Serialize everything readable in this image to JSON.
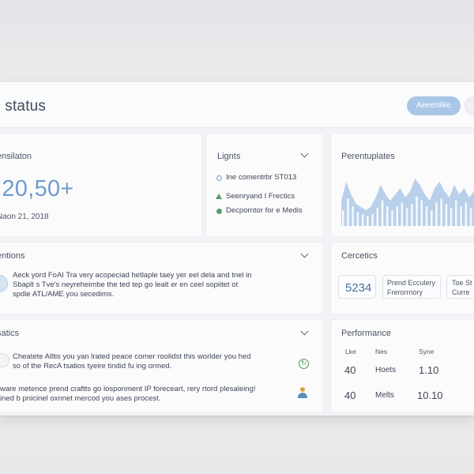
{
  "header": {
    "title": "o status",
    "primary_button": "Aeeenlike"
  },
  "card_overview": {
    "title": "ensilaton",
    "value": ",20,50+",
    "date": "Naon 21, 2018"
  },
  "card_lights": {
    "title": "Lignts",
    "items": [
      {
        "label": "Ine comentrbr ST013",
        "icon": "circle-icon",
        "color": "#6fa0cf"
      },
      {
        "label": "Seenryand I Frectics",
        "icon": "triangle-icon",
        "color": "#5a9a6a"
      },
      {
        "label": "Decporntor for e Medis",
        "icon": "dot-icon",
        "color": "#5aa06e"
      }
    ]
  },
  "card_chart": {
    "title": "Perentuplates",
    "chart_data": {
      "type": "area",
      "values": [
        8,
        14,
        10,
        7,
        6,
        5,
        6,
        9,
        13,
        10,
        8,
        10,
        12,
        9,
        11,
        15,
        13,
        10,
        8,
        12,
        14,
        11,
        9,
        13,
        10,
        12,
        9,
        11
      ]
    }
  },
  "card_actions": {
    "title": "entions",
    "lines": [
      "Aeck yord FoAI Tra very acopeciad hetlaple taey yer eel dela and tnel in",
      "Sbaplt s Tve's neyreheimbe the ted tep go lealt er en ceel sopiitet ot",
      "spdie ATL/AME you secedims."
    ]
  },
  "card_ceramics": {
    "title": "Cercetics",
    "tile_number": "5234",
    "tile2_lines": [
      "Prend Ecculery",
      "Frerorrnory"
    ],
    "tile3_lines": [
      "Toe St",
      "Curre"
    ]
  },
  "card_statics": {
    "title": "satics",
    "paragraph1": [
      "Cheatete Alltis you yan lrated peace comer roolidst this worlder you hed",
      "so of the RecA tsatios tyeire tindid fu ing ormed."
    ],
    "paragraph2": [
      "ware metence prend craftts go losponment IP foreceart, rery rtord plesaleing!",
      "ined b pnicinel oxnnet mercod you ases procest."
    ],
    "icon1_color": "#4aa05e",
    "icon2_color": "#d8a040"
  },
  "card_performance": {
    "title": "Performance",
    "headers": [
      "Lke",
      "Nes",
      "Syne"
    ],
    "rows": [
      {
        "a": "40",
        "b": "Hoets",
        "c": "1.10"
      },
      {
        "a": "40",
        "b": "Melts",
        "c": "10.10"
      }
    ]
  }
}
